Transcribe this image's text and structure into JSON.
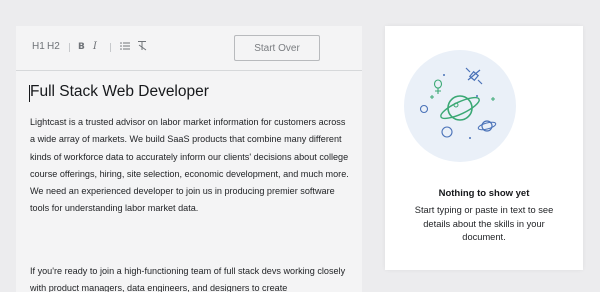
{
  "toolbar": {
    "h1_label": "H1",
    "h2_label": "H2",
    "bold_label": "B",
    "italic_label": "I",
    "start_over_label": "Start Over"
  },
  "document": {
    "title": "Full Stack Web Developer",
    "paragraphs": [
      "Lightcast is a trusted advisor on labor market information for customers across a wide array of markets. We build SaaS products that combine many different kinds of workforce data to accurately inform our clients' decisions about college course offerings, hiring, site selection, economic development, and much more. We need an experienced developer to join us in producing premier software tools for understanding labor market data.",
      "If you're ready to join a high-functioning team of full stack devs working closely with product managers, data engineers, and designers to create"
    ]
  },
  "empty_state": {
    "title": "Nothing to show yet",
    "description": "Start typing or paste in text to see details about the skills in your document."
  },
  "colors": {
    "accent_green": "#3aa874",
    "accent_blue": "#4a72b8",
    "illustration_bg": "#eaf0f8"
  }
}
